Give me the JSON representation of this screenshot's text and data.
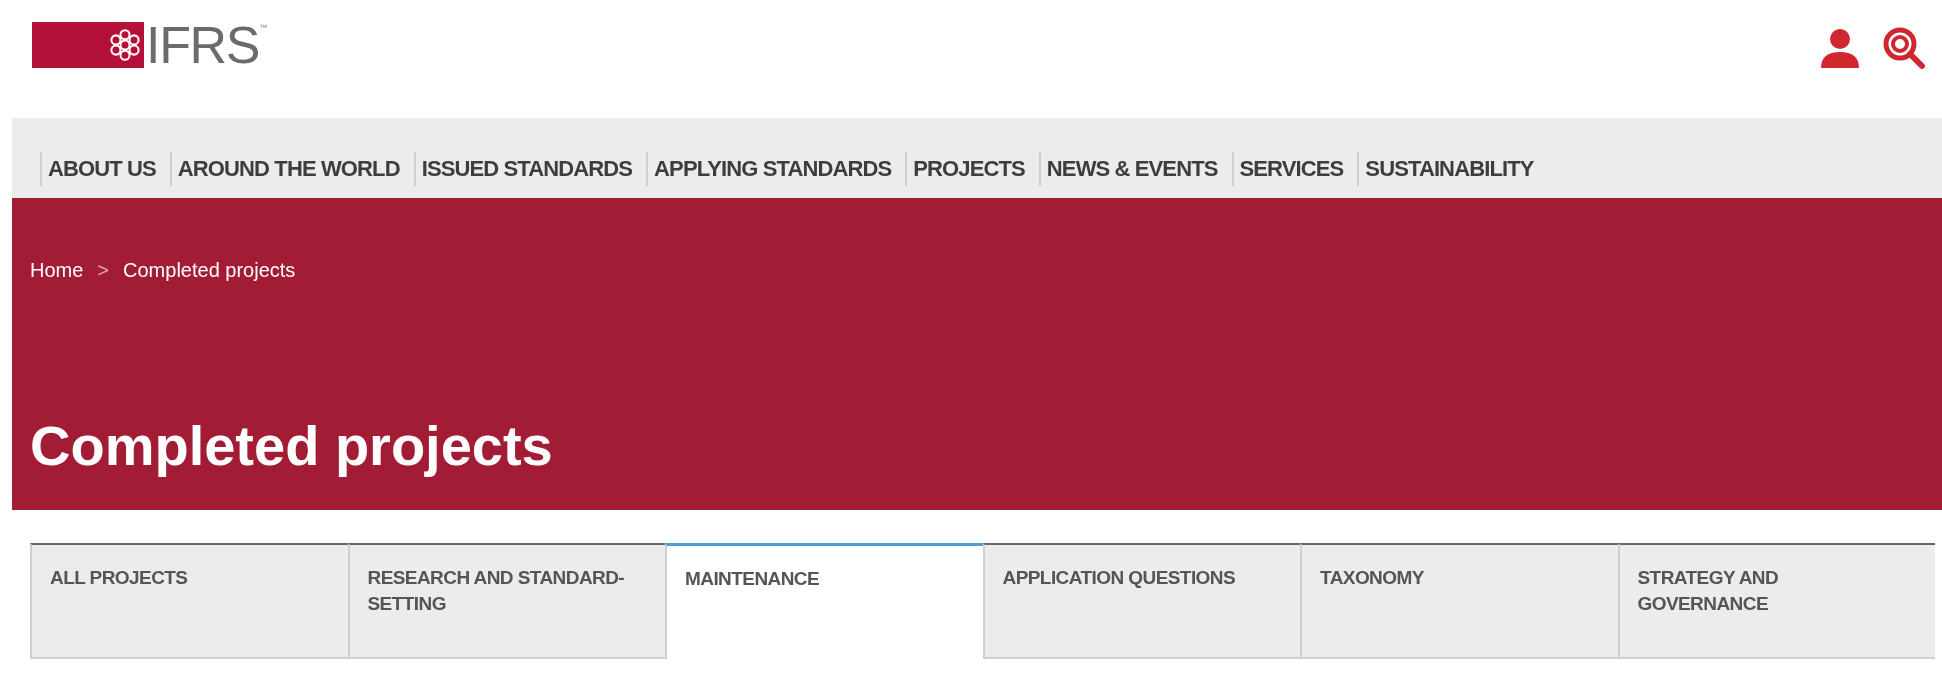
{
  "logo": {
    "text": "IFRS",
    "mark": "™"
  },
  "nav": [
    {
      "label": "ABOUT US"
    },
    {
      "label": "AROUND THE WORLD"
    },
    {
      "label": "ISSUED STANDARDS"
    },
    {
      "label": "APPLYING STANDARDS"
    },
    {
      "label": "PROJECTS"
    },
    {
      "label": "NEWS & EVENTS"
    },
    {
      "label": "SERVICES"
    },
    {
      "label": "SUSTAINABILITY"
    }
  ],
  "breadcrumb": {
    "items": [
      "Home",
      "Completed projects"
    ],
    "separator": ">"
  },
  "title": "Completed projects",
  "tabs": [
    {
      "label": "ALL PROJECTS",
      "selected": false
    },
    {
      "label": "RESEARCH AND STANDARD-SETTING",
      "selected": false
    },
    {
      "label": "MAINTENANCE",
      "selected": true
    },
    {
      "label": "APPLICATION QUESTIONS",
      "selected": false
    },
    {
      "label": "TAXONOMY",
      "selected": false
    },
    {
      "label": "STRATEGY AND GOVERNANCE",
      "selected": false
    }
  ]
}
